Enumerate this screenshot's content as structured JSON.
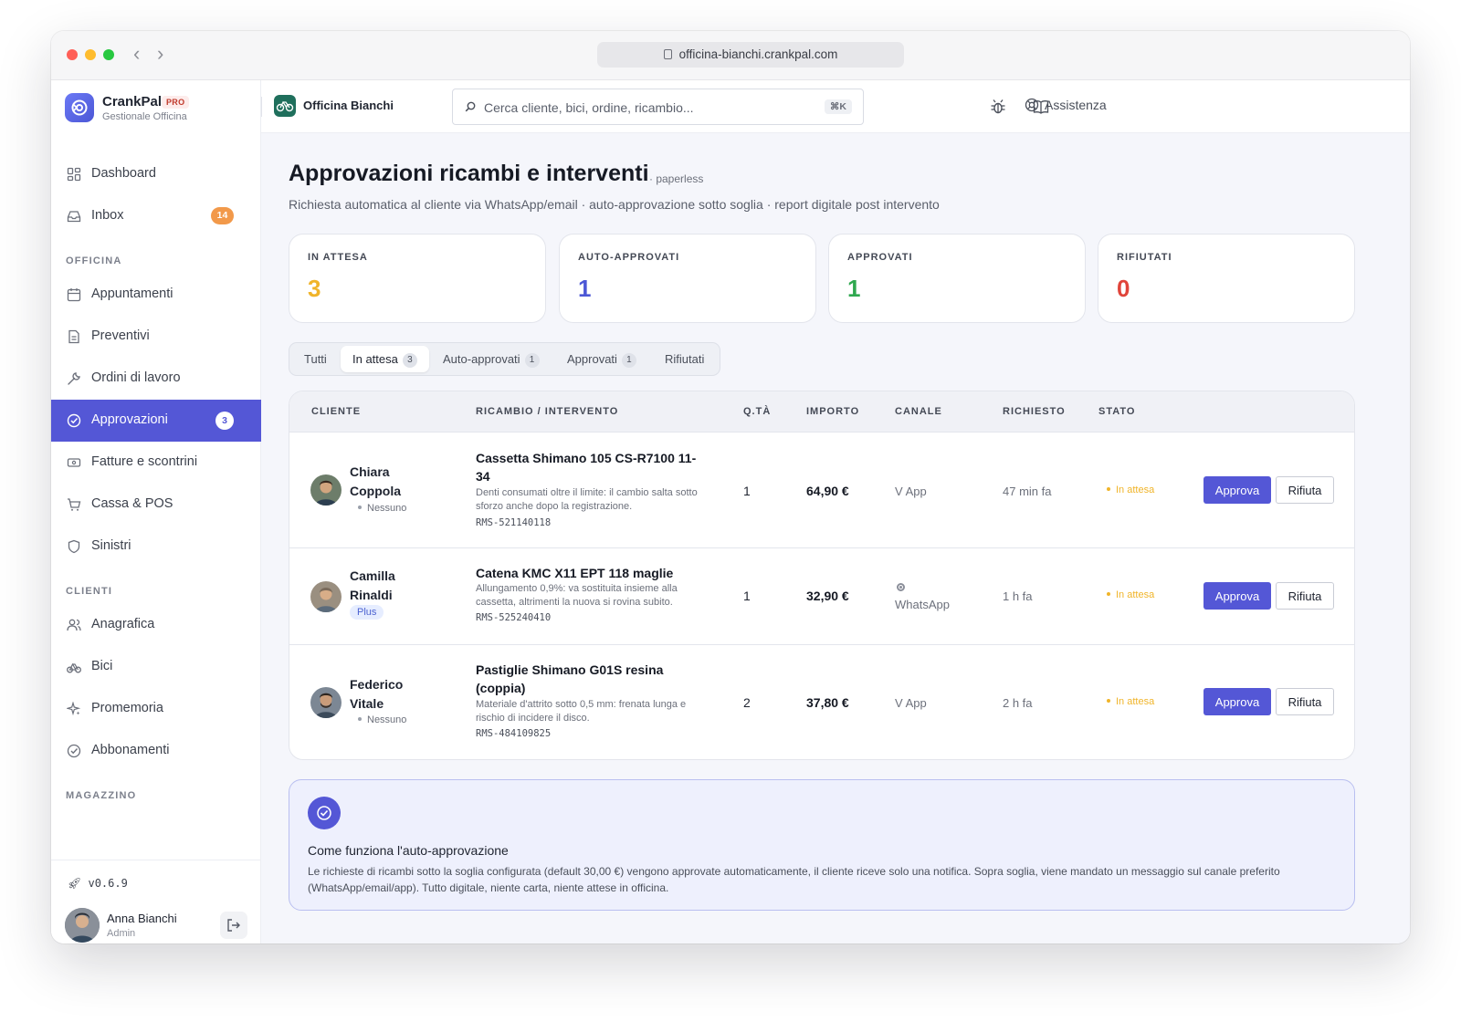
{
  "browser": {
    "url": "officina-bianchi.crankpal.com"
  },
  "brand": {
    "name": "CrankPal",
    "tier": "PRO",
    "subtitle": "Gestionale Officina"
  },
  "sidebar": {
    "items_top": [
      {
        "label": "Dashboard",
        "icon": "dashboard-icon"
      },
      {
        "label": "Inbox",
        "icon": "inbox-icon",
        "badge": "14"
      }
    ],
    "section_officina": "OFFICINA",
    "items_officina": [
      {
        "label": "Appuntamenti",
        "icon": "calendar-icon"
      },
      {
        "label": "Preventivi",
        "icon": "document-icon"
      },
      {
        "label": "Ordini di lavoro",
        "icon": "wrench-icon"
      },
      {
        "label": "Approvazioni",
        "icon": "check-circle-icon",
        "badge": "3",
        "active": true
      },
      {
        "label": "Fatture e scontrini",
        "icon": "receipt-icon"
      },
      {
        "label": "Cassa & POS",
        "icon": "cart-icon"
      },
      {
        "label": "Sinistri",
        "icon": "shield-icon"
      }
    ],
    "section_clienti": "CLIENTI",
    "items_clienti": [
      {
        "label": "Anagrafica",
        "icon": "users-icon"
      },
      {
        "label": "Bici",
        "icon": "bike-icon"
      },
      {
        "label": "Promemoria",
        "icon": "sparkle-icon"
      },
      {
        "label": "Abbonamenti",
        "icon": "check-circle-icon"
      }
    ],
    "section_magazzino": "MAGAZZINO",
    "version": "v0.6.9",
    "user": {
      "name": "Anna Bianchi",
      "role": "Admin"
    }
  },
  "topbar": {
    "shop_name": "Officina Bianchi",
    "search_placeholder": "Cerca cliente, bici, ordine, ricambio...",
    "search_shortcut": "⌘K",
    "help_label": "Assistenza"
  },
  "page": {
    "title": "Approvazioni ricambi e interventi",
    "tag": "· paperless",
    "subtitle": "Richiesta automatica al cliente via WhatsApp/email · auto-approvazione sotto soglia · report digitale post intervento"
  },
  "stats": [
    {
      "label": "IN ATTESA",
      "value": "3",
      "color": "#f0b429"
    },
    {
      "label": "AUTO-APPROVATI",
      "value": "1",
      "color": "#4c57d6"
    },
    {
      "label": "APPROVATI",
      "value": "1",
      "color": "#2fa84f"
    },
    {
      "label": "RIFIUTATI",
      "value": "0",
      "color": "#e0443a"
    }
  ],
  "filters": [
    {
      "label": "Tutti"
    },
    {
      "label": "In attesa",
      "count": "3",
      "active": true
    },
    {
      "label": "Auto-approvati",
      "count": "1"
    },
    {
      "label": "Approvati",
      "count": "1"
    },
    {
      "label": "Rifiutati"
    }
  ],
  "table": {
    "headers": [
      "CLIENTE",
      "RICAMBIO / INTERVENTO",
      "Q.TÀ",
      "IMPORTO",
      "CANALE",
      "RICHIESTO",
      "STATO"
    ],
    "approve_label": "Approva",
    "reject_label": "Rifiuta",
    "rows": [
      {
        "client": "Chiara Coppola",
        "tier": "Nessuno",
        "part": "Cassetta Shimano 105 CS-R7100 11-34",
        "desc": "Denti consumati oltre il limite: il cambio salta sotto sforzo anche dopo la registrazione.",
        "code": "RMS-521140118",
        "qty": "1",
        "amount": "64,90 €",
        "channel": "V App",
        "requested": "47 min fa",
        "status": "In attesa"
      },
      {
        "client": "Camilla Rinaldi",
        "tier": "Plus",
        "part": "Catena KMC X11 EPT 118 maglie",
        "desc": "Allungamento 0,9%: va sostituita insieme alla cassetta, altrimenti la nuova si rovina subito.",
        "code": "RMS-525240410",
        "qty": "1",
        "amount": "32,90 €",
        "channel": "WhatsApp",
        "requested": "1 h fa",
        "status": "In attesa"
      },
      {
        "client": "Federico Vitale",
        "tier": "Nessuno",
        "part": "Pastiglie Shimano G01S resina (coppia)",
        "desc": "Materiale d'attrito sotto 0,5 mm: frenata lunga e rischio di incidere il disco.",
        "code": "RMS-484109825",
        "qty": "2",
        "amount": "37,80 €",
        "channel": "V App",
        "requested": "2 h fa",
        "status": "In attesa"
      }
    ]
  },
  "info": {
    "title": "Come funziona l'auto-approvazione",
    "text": "Le richieste di ricambi sotto la soglia configurata (default 30,00 €) vengono approvate automaticamente, il cliente riceve solo una notifica. Sopra soglia, viene mandato un messaggio sul canale preferito (WhatsApp/email/app). Tutto digitale, niente carta, niente attese in officina."
  }
}
